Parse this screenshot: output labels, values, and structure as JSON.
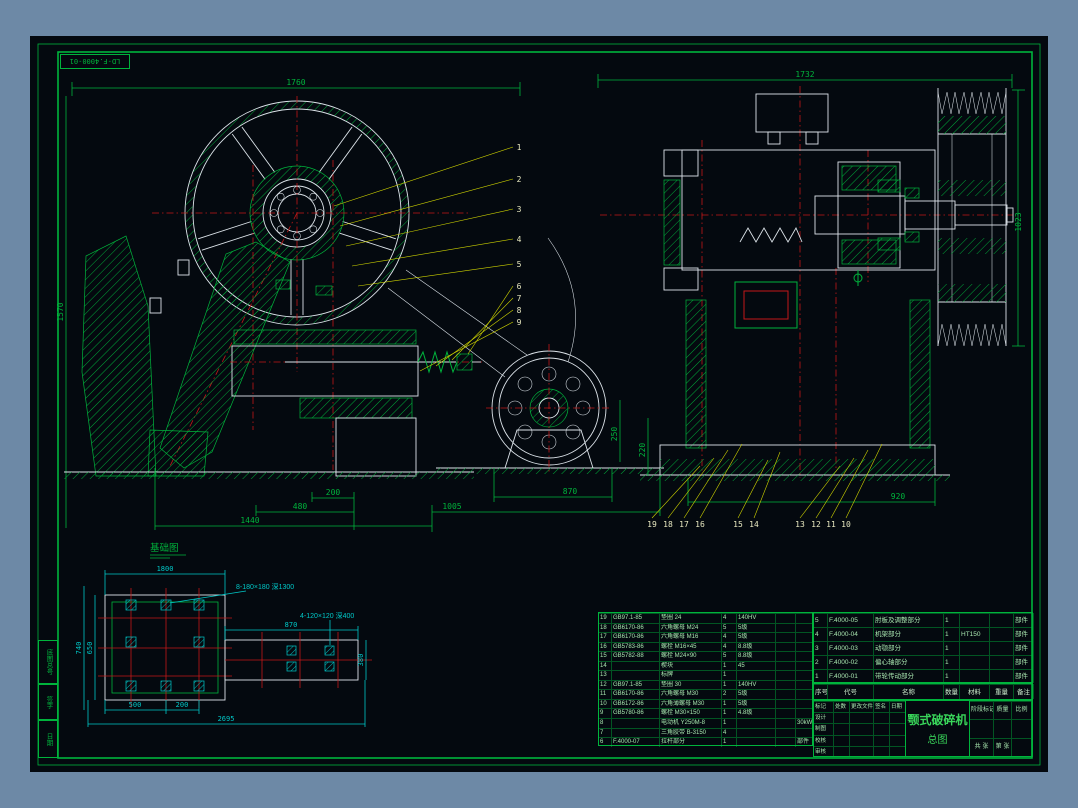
{
  "colors": {
    "bg_outer": "#6d89a6",
    "bg_sheet": "#04090f",
    "frame_green": "#00b43c",
    "line_white": "#dde4ea",
    "line_red": "#c41818",
    "line_cyan": "#00c8c8",
    "line_yellow": "#cfd400"
  },
  "frame": {
    "corner_label": "LD-F.4000-01",
    "margin_fields": [
      "底图总号",
      "签字",
      "日期"
    ]
  },
  "front_view": {
    "dims": {
      "overall_width": "1760",
      "overall_height": "1570",
      "d200": "200",
      "d480": "480",
      "d1440": "1440",
      "d1005": "1005",
      "d870": "870"
    },
    "callouts": [
      "1",
      "2",
      "3",
      "4",
      "5",
      "6",
      "7",
      "8",
      "9"
    ]
  },
  "side_view": {
    "dims": {
      "overall_width": "1732",
      "pulley_height": "1023",
      "base_width": "920",
      "pit_depth": "250",
      "pit_width": "220"
    },
    "callouts_bottom": [
      "19",
      "18",
      "17",
      "16",
      "15",
      "14",
      "13",
      "12",
      "11",
      "10"
    ]
  },
  "foundation": {
    "title": "基础图",
    "note_large_holes": "8-180×180 深1300",
    "note_small_holes": "4-120×120 深400",
    "dims": {
      "top_width": "1800",
      "ext_width": "870",
      "seg_500": "500",
      "seg_200": "200",
      "overall": "2695",
      "height_650": "650",
      "height_740": "740",
      "ext_height": "380"
    }
  },
  "parts_left": {
    "rows": [
      [
        "19",
        "GB97.1-85",
        "垫圈 24",
        "4",
        "140HV",
        "",
        ""
      ],
      [
        "18",
        "GB6170-86",
        "六角螺母 M24",
        "5",
        "5级",
        "",
        ""
      ],
      [
        "17",
        "GB6170-86",
        "六角螺母 M16",
        "4",
        "5级",
        "",
        ""
      ],
      [
        "16",
        "GB5783-86",
        "螺栓 M16×45",
        "4",
        "8.8级",
        "",
        ""
      ],
      [
        "15",
        "GB5782-88",
        "螺栓 M24×90",
        "5",
        "8.8级",
        "",
        ""
      ],
      [
        "14",
        "",
        "楔块",
        "1",
        "45",
        "",
        ""
      ],
      [
        "13",
        "",
        "标牌",
        "1",
        "",
        "",
        ""
      ],
      [
        "12",
        "GB97.1-85",
        "垫圈 30",
        "1",
        "140HV",
        "",
        ""
      ],
      [
        "11",
        "GB6170-86",
        "六角螺母 M30",
        "2",
        "5级",
        "",
        ""
      ],
      [
        "10",
        "GB6172-86",
        "六角薄螺母 M30",
        "1",
        "5级",
        "",
        ""
      ],
      [
        "9",
        "GB5780-86",
        "螺栓 M30×150",
        "1",
        "4.8级",
        "",
        ""
      ],
      [
        "8",
        "",
        "电动机 Y250M-8",
        "1",
        "",
        "",
        "30kW"
      ],
      [
        "7",
        "",
        "三角胶带 B-3150",
        "4",
        "",
        "",
        ""
      ],
      [
        "6",
        "F.4000-07",
        "拉杆部分",
        "1",
        "",
        "",
        "部件"
      ]
    ]
  },
  "parts_right": {
    "rows": [
      [
        "5",
        "F.4000-05",
        "肘板及调整部分",
        "1",
        "",
        "",
        "部件"
      ],
      [
        "4",
        "F.4000-04",
        "机架部分",
        "1",
        "HT150",
        "",
        "部件"
      ],
      [
        "3",
        "F.4000-03",
        "动颚部分",
        "1",
        "",
        "",
        "部件"
      ],
      [
        "2",
        "F.4000-02",
        "偏心轴部分",
        "1",
        "",
        "",
        "部件"
      ],
      [
        "1",
        "F.4000-01",
        "带轮传动部分",
        "1",
        "",
        "",
        "部件"
      ]
    ],
    "header": [
      "序号",
      "代号",
      "名称",
      "数量",
      "材料",
      "重量",
      "备注"
    ]
  },
  "title_block": {
    "big_title": "颚式破碎机",
    "sub_title": "总图",
    "left_rows": [
      [
        "标记",
        "处数",
        "更改文件号",
        "签名",
        "日期"
      ],
      [
        "设计",
        "",
        "",
        "",
        ""
      ],
      [
        "制图",
        "",
        "",
        "",
        ""
      ],
      [
        "校核",
        "",
        "",
        "",
        ""
      ],
      [
        "审核",
        "",
        "",
        "",
        ""
      ]
    ],
    "right_rows": [
      [
        "阶段标记",
        "质量",
        "比例"
      ],
      [
        "",
        "",
        ""
      ],
      [
        "共 张",
        "第 张",
        ""
      ]
    ]
  }
}
